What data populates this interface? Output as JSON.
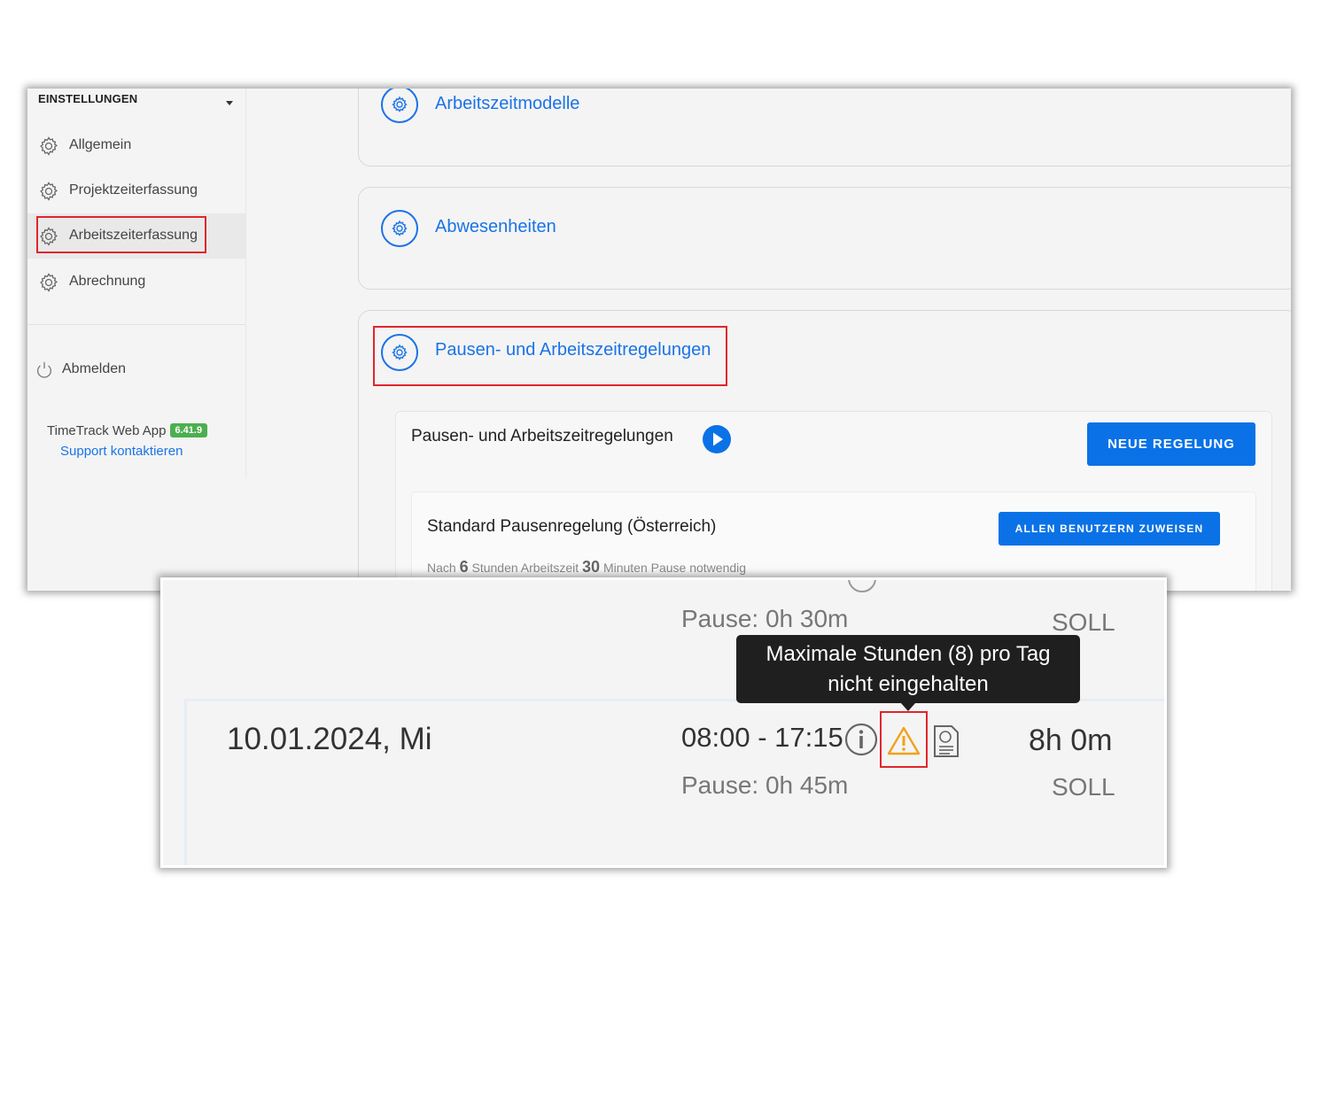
{
  "sidebar": {
    "header": "EINSTELLUNGEN",
    "items": [
      {
        "label": "Allgemein",
        "icon": "gear-icon"
      },
      {
        "label": "Projektzeiterfassung",
        "icon": "gear-icon"
      },
      {
        "label": "Arbeitszeiterfassung",
        "icon": "gear-icon",
        "active": true
      },
      {
        "label": "Abrechnung",
        "icon": "gear-icon"
      }
    ],
    "logout_label": "Abmelden",
    "app_name": "TimeTrack Web App",
    "version": "6.41.9",
    "support_link": "Support kontaktieren"
  },
  "cards": [
    {
      "title": "Arbeitszeitmodelle"
    },
    {
      "title": "Abwesenheiten"
    },
    {
      "title": "Pausen- und Arbeitszeitregelungen"
    }
  ],
  "rules_panel": {
    "title": "Pausen- und Arbeitszeitregelungen",
    "new_button": "NEUE REGELUNG",
    "rule": {
      "title": "Standard Pausenregelung (Österreich)",
      "assign_button": "ALLEN BENUTZERN ZUWEISEN",
      "desc_prefix": "Nach",
      "hours": "6",
      "desc_mid": "Stunden Arbeitszeit",
      "minutes": "30",
      "desc_suffix": "Minuten Pause notwendig"
    }
  },
  "timesheet": {
    "prev_pause": "Pause: 0h 30m",
    "prev_soll": "SOLL",
    "tooltip_line1": "Maximale Stunden (8) pro Tag",
    "tooltip_line2": "nicht eingehalten",
    "row": {
      "date": "10.01.2024, Mi",
      "time": "08:00 - 17:15",
      "pause": "Pause: 0h 45m",
      "hours": "8h 0m",
      "soll": "SOLL"
    }
  },
  "colors": {
    "accent": "#1a73e8",
    "button": "#0a72e6",
    "highlight": "#e0262b",
    "warning": "#f0a21a",
    "version_badge": "#4caf50"
  }
}
